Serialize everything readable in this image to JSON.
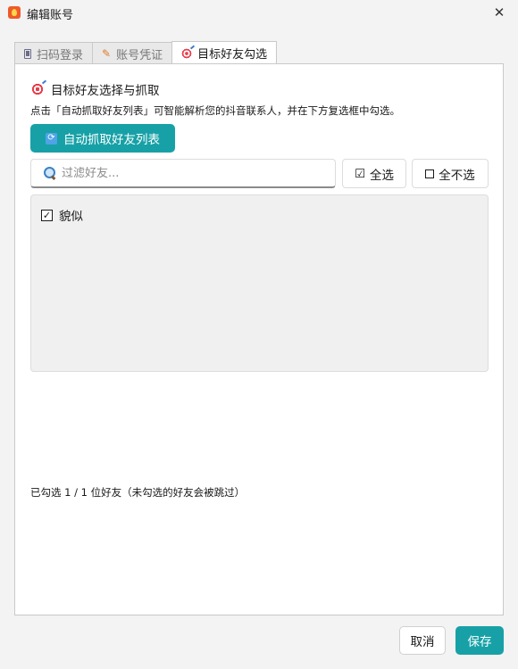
{
  "window": {
    "title": "编辑账号",
    "close_glyph": "✕"
  },
  "tabs": [
    {
      "label": "扫码登录",
      "icon": "phone-icon",
      "active": false
    },
    {
      "label": "账号凭证",
      "icon": "pencil-icon",
      "active": false
    },
    {
      "label": "目标好友勾选",
      "icon": "target-icon",
      "active": true
    }
  ],
  "section": {
    "heading": "目标好友选择与抓取",
    "description": "点击「自动抓取好友列表」可智能解析您的抖音联系人，并在下方复选框中勾选。",
    "fetch_button": "自动抓取好友列表"
  },
  "filter": {
    "value": "",
    "placeholder": "过滤好友..."
  },
  "select_all": {
    "label": "全选",
    "glyph": "☑"
  },
  "select_none": {
    "label": "全不选"
  },
  "friends": [
    {
      "name": "貌似",
      "checked": true
    }
  ],
  "summary": "已勾选 1 / 1 位好友（未勾选的好友会被跳过）",
  "footer": {
    "cancel": "取消",
    "save": "保存"
  },
  "colors": {
    "accent": "#17a1a7",
    "app_icon": "#ee5a2a"
  }
}
